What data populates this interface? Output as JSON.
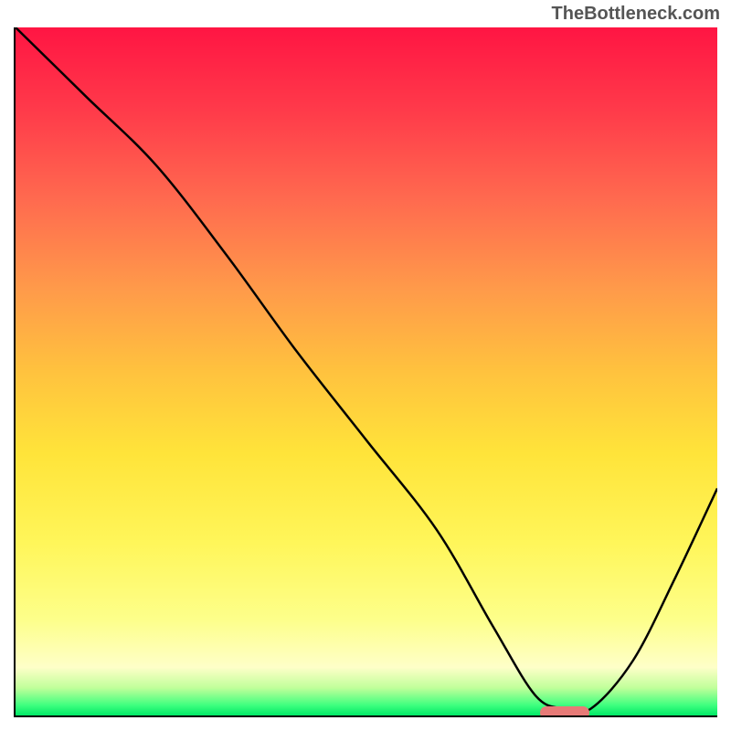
{
  "watermark": "TheBottleneck.com",
  "chart_data": {
    "type": "line",
    "title": "",
    "xlabel": "",
    "ylabel": "",
    "xlim": [
      0,
      100
    ],
    "ylim": [
      0,
      100
    ],
    "series": [
      {
        "name": "curve",
        "x": [
          0,
          10,
          20,
          30,
          40,
          50,
          60,
          68,
          74,
          78,
          82,
          88,
          94,
          100
        ],
        "y": [
          100,
          90,
          80,
          67,
          53,
          40,
          27,
          13,
          3,
          1,
          1,
          8,
          20,
          33
        ]
      }
    ],
    "marker": {
      "x_center": 78,
      "y": 0.7,
      "width": 7
    },
    "gradient_note": "background vertical gradient red->orange->yellow->green"
  }
}
